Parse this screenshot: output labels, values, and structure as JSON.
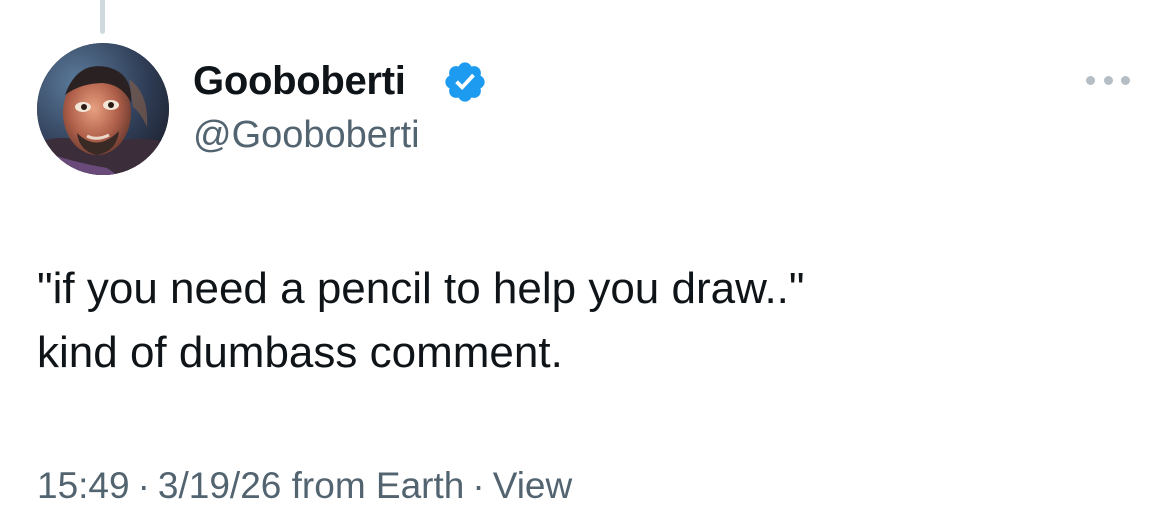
{
  "tweet": {
    "author": {
      "display_name": "Gooboberti",
      "handle": "@Gooboberti",
      "verified_icon": "verified-badge-icon",
      "avatar": "profile photo"
    },
    "text_lines": [
      "\"if you need a pencil to help you draw..\"",
      "kind of dumbass comment."
    ],
    "meta": {
      "time": "15:49",
      "separator": "·",
      "date_source": "3/19/26 from Earth",
      "views_label": "View"
    },
    "more_icon": "more-options-icon",
    "colors": {
      "text": "#0f1419",
      "secondary": "#536471",
      "verified": "#1d9bf0",
      "thread_line": "#cfd9de"
    }
  }
}
